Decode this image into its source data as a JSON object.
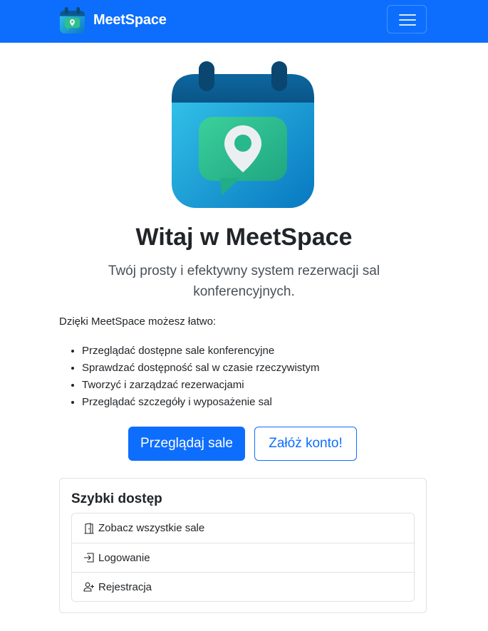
{
  "navbar": {
    "brand_name": "MeetSpace",
    "brand_logo_icon": "calendar-location-icon",
    "toggler_icon": "hamburger-menu-icon"
  },
  "hero": {
    "logo_icon": "calendar-location-icon",
    "title": "Witaj w MeetSpace",
    "lead": "Twój prosty i efektywny system rezerwacji sal konferencyjnych."
  },
  "intro": "Dzięki MeetSpace możesz łatwo:",
  "features": [
    "Przeglądać dostępne sale konferencyjne",
    "Sprawdzać dostępność sal w czasie rzeczywistym",
    "Tworzyć i zarządzać rezerwacjami",
    "Przeglądać szczegóły i wyposażenie sal"
  ],
  "buttons": {
    "browse_label": "Przeglądaj sale",
    "register_label": "Załóż konto!"
  },
  "quick_access": {
    "title": "Szybki dostęp",
    "items": [
      {
        "label": "Zobacz wszystkie sale",
        "icon": "door-icon"
      },
      {
        "label": "Logowanie",
        "icon": "login-icon"
      },
      {
        "label": "Rejestracja",
        "icon": "person-add-icon"
      }
    ]
  },
  "colors": {
    "primary": "#0d6efd",
    "calendar_top": "#0b5a8f",
    "calendar_body": "#1a9ad6",
    "bubble": "#2fbf8f"
  }
}
